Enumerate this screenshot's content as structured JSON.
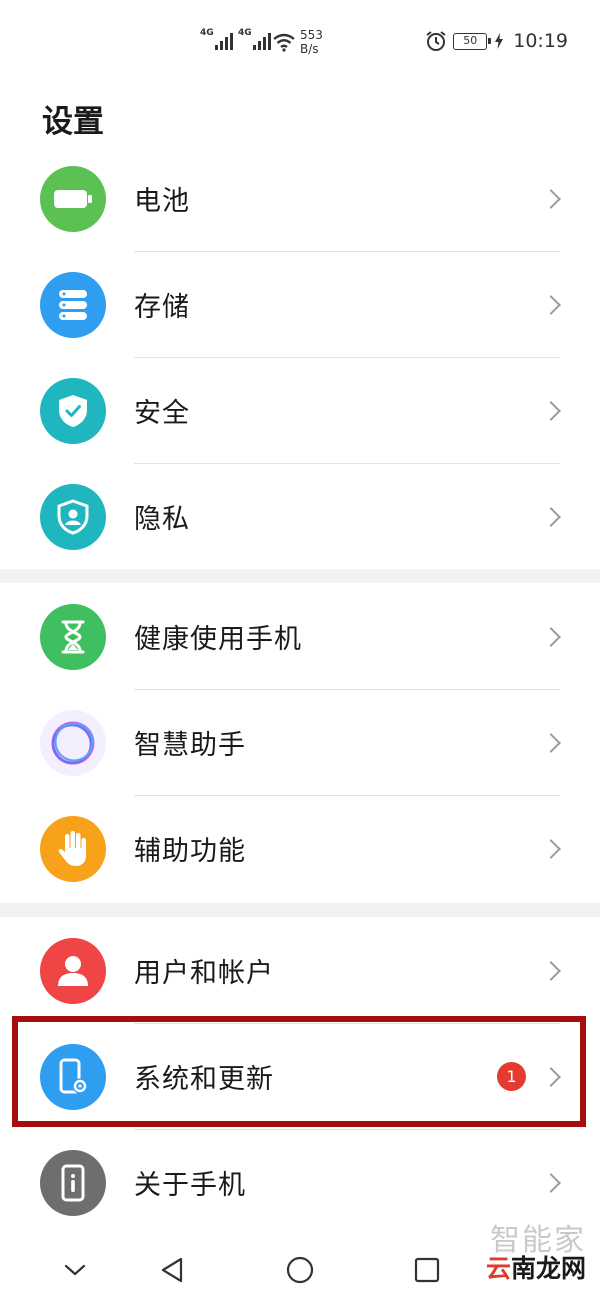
{
  "status_bar": {
    "net1": "4G",
    "net2": "4G",
    "speed_value": "553",
    "speed_unit": "B/s",
    "battery": "50",
    "time": "10:19"
  },
  "page_title": "设置",
  "groups": [
    {
      "items": [
        {
          "label": "电池",
          "icon": "battery-icon",
          "color": "#5bc152"
        },
        {
          "label": "存储",
          "icon": "storage-icon",
          "color": "#2f9df0"
        },
        {
          "label": "安全",
          "icon": "shield-check-icon",
          "color": "#1fb6c0"
        },
        {
          "label": "隐私",
          "icon": "privacy-icon",
          "color": "#1fb6c0"
        }
      ]
    },
    {
      "items": [
        {
          "label": "健康使用手机",
          "icon": "hourglass-icon",
          "color": "#3fbf5f"
        },
        {
          "label": "智慧助手",
          "icon": "assistant-ring-icon",
          "color": "#f3efff"
        },
        {
          "label": "辅助功能",
          "icon": "hand-icon",
          "color": "#f8a21b"
        }
      ]
    },
    {
      "items": [
        {
          "label": "用户和帐户",
          "icon": "user-icon",
          "color": "#ef4545"
        },
        {
          "label": "系统和更新",
          "icon": "phone-gear-icon",
          "color": "#2f9df0",
          "badge": "1"
        },
        {
          "label": "关于手机",
          "icon": "phone-info-icon",
          "color": "#6e6e6e"
        }
      ]
    }
  ],
  "highlight_color": "#a60d0d",
  "navbar": {
    "buttons": [
      "chevron-down-icon",
      "back-icon",
      "home-icon",
      "recents-icon"
    ]
  },
  "watermark": {
    "top": "智能家",
    "bottom_chars": [
      "云",
      "南",
      "龙",
      "网"
    ]
  }
}
